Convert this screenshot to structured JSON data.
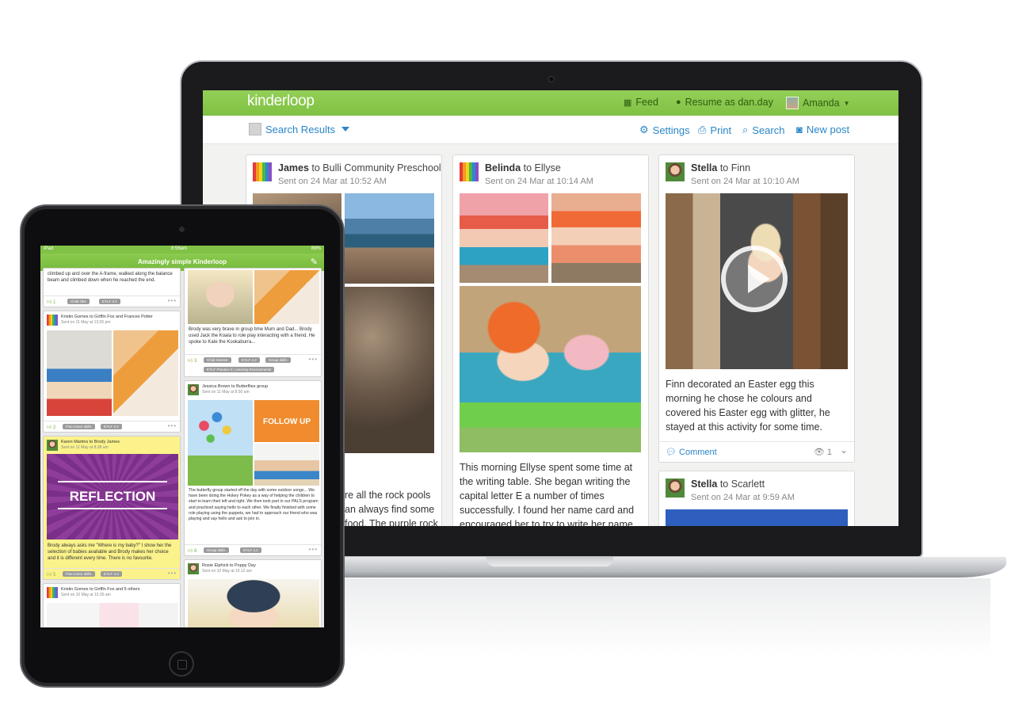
{
  "desktop": {
    "brand": "kinderloop",
    "header": {
      "feed_label": "Feed",
      "resume_label": "Resume as dan.day",
      "user_label": "Amanda"
    },
    "toolbar": {
      "search_results_label": "Search Results",
      "settings_label": "Settings",
      "print_label": "Print",
      "search_label": "Search",
      "new_post_label": "New post"
    },
    "posts": [
      {
        "author": "James",
        "to_text": " to Bulli Community Preschool",
        "sent": "Sent on 24 Mar at 10:52 AM",
        "body": "re all the rock pools\nan always find some\nfood. The purple rock"
      },
      {
        "author": "Belinda",
        "to_text": " to Ellyse",
        "sent": "Sent on 24 Mar at 10:14 AM",
        "body": "This morning Ellyse spent some time at the writing table. She began writing the capital letter E a number of times successfully. I found her name card and encouraged her to try to write her name. Ellyse chose a"
      },
      {
        "author": "Stella",
        "to_text": " to Finn",
        "sent": "Sent on 24 Mar at 10:10 AM",
        "body": "Finn decorated an Easter egg this morning he chose he colours and covered his Easter egg with glitter, he stayed at this activity for some time.",
        "comment_label": "Comment",
        "views": "1"
      },
      {
        "author": "Stella",
        "to_text": " to Scarlett",
        "sent": "Sent on 24 Mar at 9:59 AM"
      }
    ]
  },
  "tablet": {
    "status_left": "iPad",
    "status_time": "8:56am",
    "status_battery": "89%",
    "title": "Amazingly simple Kinderloop",
    "left_column": [
      {
        "text": "climbed up and over the A-frame, walked along the balance beam and climbed down when he reached the end.",
        "likes": "1",
        "tags": [
          "Child Obs",
          "EYLF 3.2"
        ]
      },
      {
        "title": "Kristin Gomes to Griffin Fox and Frances Potter",
        "sent": "Sent on 11 May at 13.55 pm",
        "likes": "2",
        "tags": [
          "Fine motor skills",
          "EYLF 2.2"
        ]
      },
      {
        "title": "Karen Martins to Brody James",
        "sent": "Sent on 11 May at 8.38 am",
        "image_word": "REFLECTION",
        "text": "Brody always asks me \"Where is my baby?\" I show her the selection of babies available and Brody makes her choice and it is different every time. There is no favourite.",
        "likes": "5",
        "tags": [
          "Fine motor skills",
          "EYLF 4.3"
        ]
      },
      {
        "title": "Kristin Gomes to Griffin Fox and 5 others",
        "sent": "Sent on 10 May at 10.35 am"
      }
    ],
    "right_column": [
      {
        "text": "Brody was very brave in group time Mum and Dad... Brody used Jack the Koala to role play interacting with a friend. He spoke to Kate the Kookaburra...",
        "likes": "3",
        "tags": [
          "Child Interest",
          "EYLF 4.2",
          "Group skills"
        ],
        "tag_wide": "EYLF Practice 6: Learning Environments"
      },
      {
        "title": "Jessica Brown to Butterflies group",
        "sent": "Sent on 11 May at 8.50 am",
        "image_word": "FOLLOW UP",
        "text": "The butterfly group started off the day with some outdoor songs... We have been doing the Hokey Pokey as a way of helping the children to start to learn their left and right. We then took part in our PALS program and practiced saying hello to each other. We finally finished with some role playing using the puppets, we had to approach our friend who was playing and say hello and ask to join in.",
        "likes": "8",
        "tags": [
          "Group skills",
          "EYLF 2.2"
        ]
      },
      {
        "title": "Rosie Elphick to Poppy Day",
        "sent": "Sent on 10 May at 10.12 am"
      }
    ]
  }
}
